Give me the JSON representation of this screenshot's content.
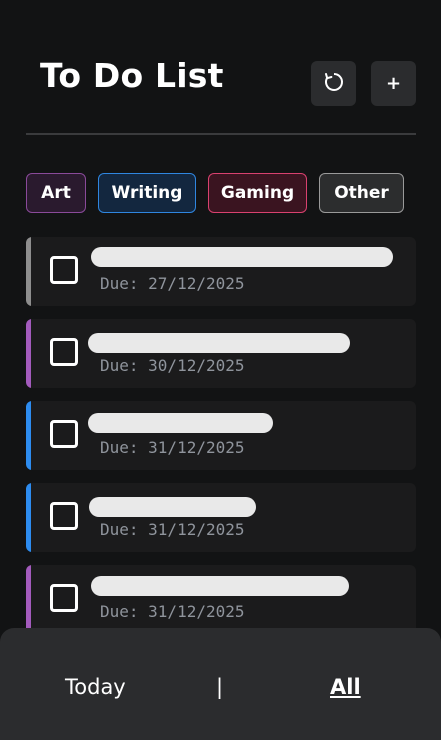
{
  "header": {
    "title": "To Do List",
    "refresh_icon": "refresh-icon",
    "add_label": "+"
  },
  "categories": [
    {
      "label": "Art",
      "border": "#8a4a9a",
      "bg": "#2a1a2e"
    },
    {
      "label": "Writing",
      "border": "#2f86e0",
      "bg": "#13273f"
    },
    {
      "label": "Gaming",
      "border": "#d9416f",
      "bg": "#3a1420"
    },
    {
      "label": "Other",
      "border": "#9a9a9a",
      "bg": "#2c2d2e"
    }
  ],
  "tasks": [
    {
      "due": "Due: 27/12/2025",
      "accent": "#8e8e8e"
    },
    {
      "due": "Due: 30/12/2025",
      "accent": "#a35bbd"
    },
    {
      "due": "Due: 31/12/2025",
      "accent": "#2d8cf0"
    },
    {
      "due": "Due: 31/12/2025",
      "accent": "#2d8cf0"
    },
    {
      "due": "Due: 31/12/2025",
      "accent": "#a35bbd"
    }
  ],
  "nav": {
    "today": "Today",
    "separator": "|",
    "all": "All"
  }
}
